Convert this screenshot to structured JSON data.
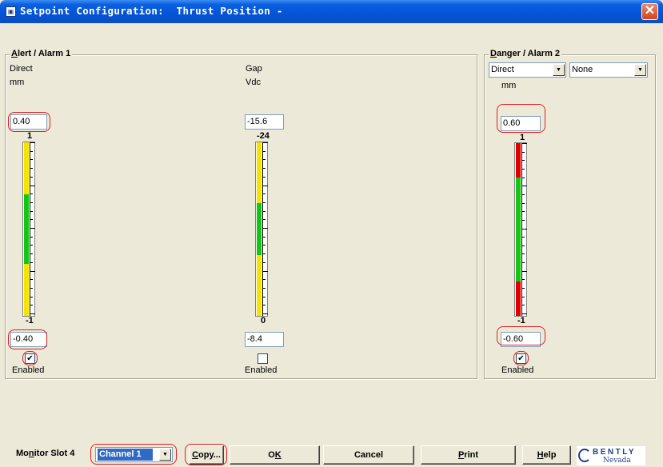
{
  "window": {
    "title": "Setpoint Configuration:  Thrust Position -"
  },
  "alert_group": {
    "legend_first": "A",
    "legend_rest": "lert / Alarm 1",
    "direct": {
      "label1": "Direct",
      "label2": "mm",
      "upper_value": "0.40",
      "scale_top": "1",
      "scale_bottom": "-1",
      "lower_value": "-0.40",
      "enabled_label": "Enabled",
      "enabled": true,
      "green_start": 0.3,
      "green_end": 0.7
    },
    "gap": {
      "label1": "Gap",
      "label2": "Vdc",
      "upper_value": "-15.6",
      "scale_top": "-24",
      "scale_bottom": "0",
      "lower_value": "-8.4",
      "enabled_label": "Enabled",
      "enabled": false,
      "green_start": 0.35,
      "green_end": 0.65
    }
  },
  "danger_group": {
    "legend_first": "D",
    "legend_rest": "anger / Alarm 2",
    "mode_select": "Direct",
    "sub_select": "None",
    "unit": "mm",
    "upper_value": "0.60",
    "scale_top": "1",
    "scale_bottom": "-1",
    "lower_value": "-0.60",
    "enabled_label": "Enabled",
    "enabled": true,
    "green_start": 0.2,
    "green_end": 0.8
  },
  "footer": {
    "monitor_label_a": "Mo",
    "monitor_label_u": "n",
    "monitor_label_b": "itor Slot 4",
    "channel_select": "Channel 1",
    "copy_label_u": "C",
    "copy_label_rest": "opy...",
    "ok_label_a": "O",
    "ok_label_u": "K",
    "cancel_label": "Cancel",
    "print_label_u": "P",
    "print_label_rest": "rint",
    "help_label_u": "H",
    "help_label_rest": "elp"
  },
  "logo": {
    "brand_top": "BENTLY",
    "brand_bottom": "Nevada"
  },
  "colors": {
    "yellow": "#f4e400",
    "green": "#13c613",
    "red": "#e00000",
    "highlight": "#e02020"
  }
}
